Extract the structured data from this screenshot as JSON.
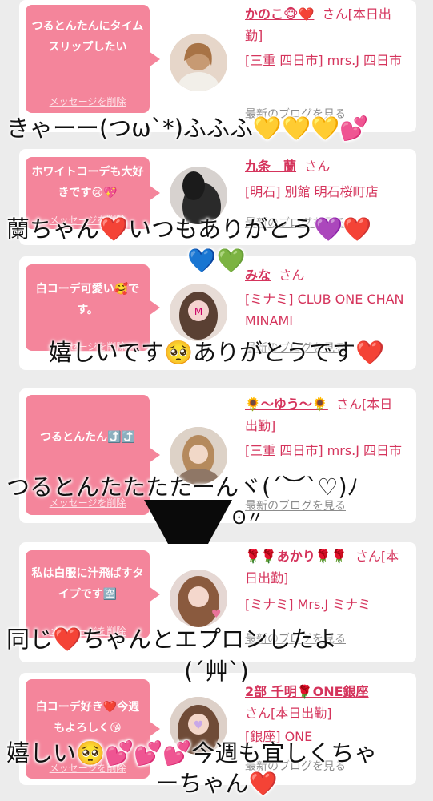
{
  "cards": [
    {
      "bubble": "つるとんたんにタイムスリップしたい",
      "delete": "メッセージを削除",
      "name": "かのこ🐵❤️",
      "san": "さん[本日出勤]",
      "area": "[三重 四日市] mrs.J 四日市",
      "blog": "最新のブログを見る"
    },
    {
      "bubble": "ホワイトコーデも大好きです😢💖",
      "delete": "メッセージを削除",
      "name": "九条　蘭",
      "san": "さん",
      "area": "[明石] 別館 明石桜町店",
      "blog": "最新のブログを見る"
    },
    {
      "bubble": "白コーデ可愛い🥰です。",
      "delete": "メッセージを削除",
      "name": "みな",
      "san": "さん",
      "area": "[ミナミ] CLUB ONE CHAN MINAMI",
      "blog": "最新のブログを見る"
    },
    {
      "bubble": "つるとんたん⤴️⤴️",
      "delete": "メッセージを削除",
      "name": "🌻〜ゆう〜🌻",
      "san": "さん[本日出勤]",
      "area": "[三重 四日市] mrs.J 四日市",
      "blog": "最新のブログを見る"
    },
    {
      "bubble": "私は白服に汁飛ばすタイプです🈳",
      "delete": "メッセージを削除",
      "name": "🌹🌹あかり🌹🌹",
      "san": "さん[本日出勤]",
      "area": "[ミナミ] Mrs.J ミナミ",
      "blog": "最新のブログを見る"
    },
    {
      "bubble": "白コーデ好き❤️今週もよろしく😘",
      "delete": "メッセージを削除",
      "name": "2部 千明🌹ONE銀座",
      "san": "さん[本日出勤]",
      "area": "[銀座] ONE",
      "blog": "最新のブログを見る"
    }
  ],
  "comments": [
    "きゃーー(つω`*)ふふふ💛💛💛💕",
    "蘭ちゃん❤️いつもありがとう💜❤️",
    "💙💚",
    "嬉しいです🥺ありがとうです❤️",
    "つるとんたたたたーんヾ(´︶`♡)ﾉ",
    "ʘ〃",
    "同じ❤️ちゃんとエプロンしたよ",
    "(´艸`)",
    "嬉しい🥺💕💕💕今週も宜しくちゃ",
    "ーちゃん❤️"
  ]
}
